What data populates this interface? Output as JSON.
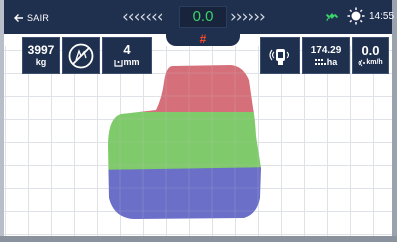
{
  "topbar": {
    "back_label": "SAIR",
    "left_chevrons": "‹‹‹‹‹‹‹",
    "right_chevrons": "››››››",
    "guidance_offset": "0.0",
    "clock": "14:55"
  },
  "status": {
    "symbol": "#"
  },
  "tiles": {
    "area_value": "3997",
    "area_unit": "kg",
    "width_value": "4",
    "width_unit": "mm",
    "coverage_value": "174.29",
    "coverage_unit": "ha",
    "speed_value": "0.0",
    "speed_unit": "km/h"
  },
  "map": {
    "zones": [
      {
        "name": "red",
        "color": "#d5707a"
      },
      {
        "name": "green",
        "color": "#7fca6a"
      },
      {
        "name": "blue",
        "color": "#6b6fc7"
      }
    ]
  },
  "colors": {
    "bar": "#1f2f4e",
    "offset_text": "#39d36b",
    "alert": "#ff4a2a"
  }
}
